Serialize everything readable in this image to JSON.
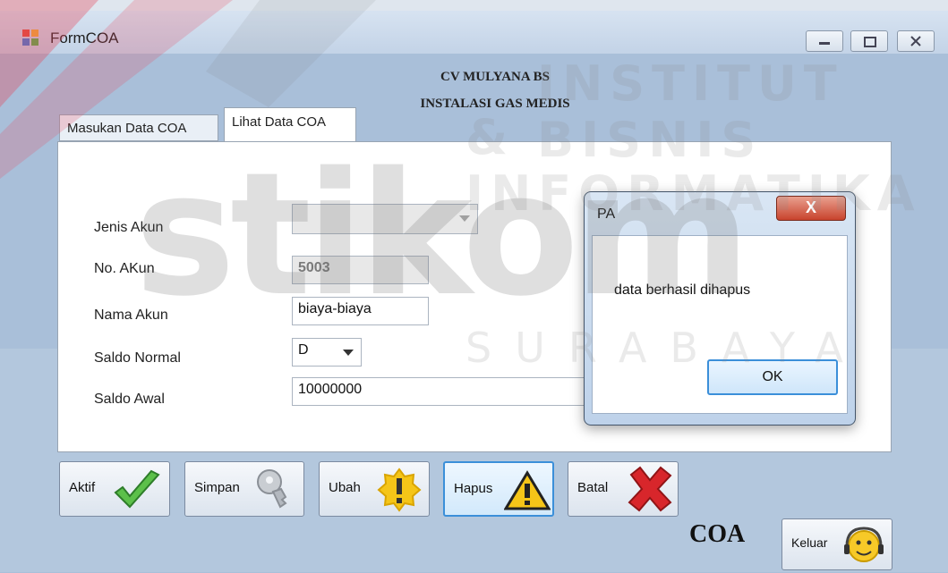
{
  "window": {
    "title": "FormCOA"
  },
  "header": {
    "line1": "CV MULYANA BS",
    "line2": "INSTALASI GAS MEDIS"
  },
  "tabs": [
    {
      "label": "Masukan Data COA",
      "active": false
    },
    {
      "label": "Lihat Data COA",
      "active": true
    }
  ],
  "form": {
    "jenis_akun": {
      "label": "Jenis Akun",
      "value": ""
    },
    "no_akun": {
      "label": "No. AKun",
      "value": "5003"
    },
    "nama_akun": {
      "label": "Nama Akun",
      "value": "biaya-biaya"
    },
    "saldo_normal": {
      "label": "Saldo Normal",
      "value": "D"
    },
    "saldo_awal": {
      "label": "Saldo Awal",
      "value": "10000000"
    }
  },
  "buttons": {
    "aktif": "Aktif",
    "simpan": "Simpan",
    "ubah": "Ubah",
    "hapus": "Hapus",
    "batal": "Batal",
    "keluar": "Keluar"
  },
  "footer_label": "COA",
  "dialog": {
    "title": "PA",
    "close": "X",
    "message": "data berhasil dihapus",
    "ok": "OK"
  },
  "watermark": {
    "line1": "INSTITUT BISNIS",
    "line2": "& INFORMATIKA",
    "logo": "stikom",
    "line3": "SURABAYA"
  },
  "colors": {
    "accent": "#3b8fd9",
    "check": "#5cc04a",
    "delete": "#d8262b",
    "warning": "#f5c518"
  }
}
